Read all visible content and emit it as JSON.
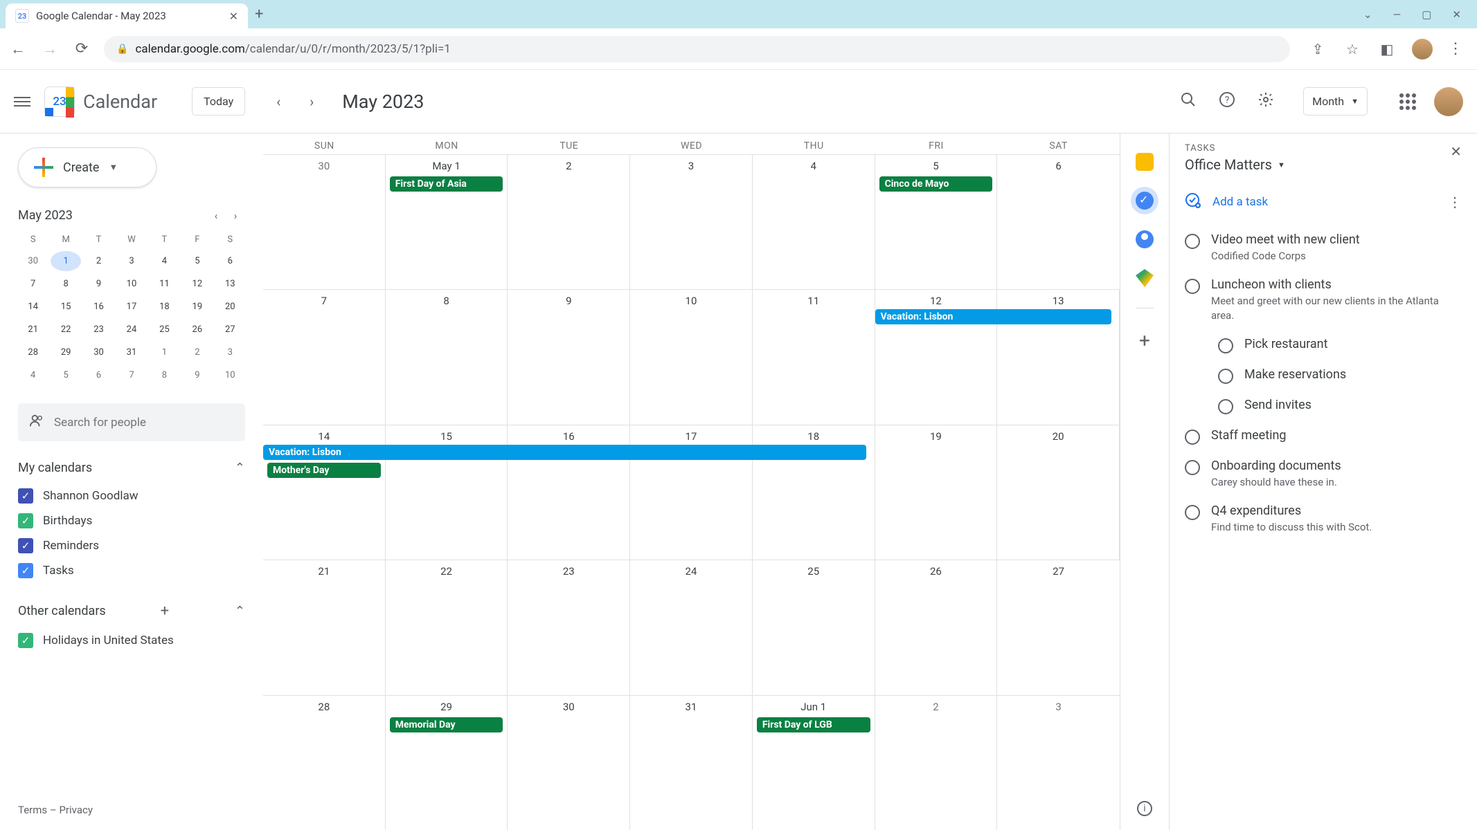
{
  "browser": {
    "tab_title": "Google Calendar - May 2023",
    "url_prefix": "calendar.google.com",
    "url_path": "/calendar/u/0/r/month/2023/5/1?pli=1",
    "favicon_text": "23"
  },
  "header": {
    "logo_day": "23",
    "app_name": "Calendar",
    "today_label": "Today",
    "current_period": "May 2023",
    "view_label": "Month"
  },
  "sidebar": {
    "create_label": "Create",
    "mini_month": "May 2023",
    "mini_day_headers": [
      "S",
      "M",
      "T",
      "W",
      "T",
      "F",
      "S"
    ],
    "mini_days": [
      {
        "n": "30",
        "muted": true
      },
      {
        "n": "1",
        "selected": true
      },
      {
        "n": "2"
      },
      {
        "n": "3"
      },
      {
        "n": "4"
      },
      {
        "n": "5"
      },
      {
        "n": "6"
      },
      {
        "n": "7"
      },
      {
        "n": "8"
      },
      {
        "n": "9"
      },
      {
        "n": "10"
      },
      {
        "n": "11"
      },
      {
        "n": "12"
      },
      {
        "n": "13"
      },
      {
        "n": "14"
      },
      {
        "n": "15"
      },
      {
        "n": "16"
      },
      {
        "n": "17"
      },
      {
        "n": "18"
      },
      {
        "n": "19"
      },
      {
        "n": "20"
      },
      {
        "n": "21"
      },
      {
        "n": "22"
      },
      {
        "n": "23"
      },
      {
        "n": "24"
      },
      {
        "n": "25"
      },
      {
        "n": "26"
      },
      {
        "n": "27"
      },
      {
        "n": "28"
      },
      {
        "n": "29"
      },
      {
        "n": "30"
      },
      {
        "n": "31"
      },
      {
        "n": "1",
        "muted": true
      },
      {
        "n": "2",
        "muted": true
      },
      {
        "n": "3",
        "muted": true
      },
      {
        "n": "4",
        "muted": true
      },
      {
        "n": "5",
        "muted": true
      },
      {
        "n": "6",
        "muted": true
      },
      {
        "n": "7",
        "muted": true
      },
      {
        "n": "8",
        "muted": true
      },
      {
        "n": "9",
        "muted": true
      },
      {
        "n": "10",
        "muted": true
      }
    ],
    "search_placeholder": "Search for people",
    "my_calendars_label": "My calendars",
    "my_calendars": [
      {
        "label": "Shannon Goodlaw",
        "color": "cb-blue"
      },
      {
        "label": "Birthdays",
        "color": "cb-green"
      },
      {
        "label": "Reminders",
        "color": "cb-blue"
      },
      {
        "label": "Tasks",
        "color": "cb-lblue"
      }
    ],
    "other_calendars_label": "Other calendars",
    "other_calendars": [
      {
        "label": "Holidays in United States",
        "color": "cb-green"
      }
    ],
    "terms": "Terms",
    "privacy": "Privacy"
  },
  "calendar": {
    "day_headers": [
      "SUN",
      "MON",
      "TUE",
      "WED",
      "THU",
      "FRI",
      "SAT"
    ],
    "weeks": [
      {
        "days": [
          {
            "num": "30",
            "muted": true
          },
          {
            "num": "May 1",
            "events": [
              {
                "title": "First Day of Asia",
                "color": "green"
              }
            ]
          },
          {
            "num": "2"
          },
          {
            "num": "3"
          },
          {
            "num": "4"
          },
          {
            "num": "5",
            "events": [
              {
                "title": "Cinco de Mayo",
                "color": "green"
              }
            ]
          },
          {
            "num": "6"
          }
        ]
      },
      {
        "days": [
          {
            "num": "7"
          },
          {
            "num": "8"
          },
          {
            "num": "9"
          },
          {
            "num": "10"
          },
          {
            "num": "11"
          },
          {
            "num": "12"
          },
          {
            "num": "13"
          }
        ],
        "span": {
          "title": "Vacation: Lisbon",
          "start": 5,
          "end": 7
        }
      },
      {
        "days": [
          {
            "num": "14",
            "events": [
              {
                "title": "Mother's Day",
                "color": "green",
                "offset": true
              }
            ]
          },
          {
            "num": "15"
          },
          {
            "num": "16"
          },
          {
            "num": "17"
          },
          {
            "num": "18"
          },
          {
            "num": "19"
          },
          {
            "num": "20"
          }
        ],
        "span": {
          "title": "Vacation: Lisbon",
          "start": 0,
          "end": 5
        }
      },
      {
        "days": [
          {
            "num": "21"
          },
          {
            "num": "22"
          },
          {
            "num": "23"
          },
          {
            "num": "24"
          },
          {
            "num": "25"
          },
          {
            "num": "26"
          },
          {
            "num": "27"
          }
        ]
      },
      {
        "days": [
          {
            "num": "28"
          },
          {
            "num": "29",
            "events": [
              {
                "title": "Memorial Day",
                "color": "green"
              }
            ]
          },
          {
            "num": "30"
          },
          {
            "num": "31"
          },
          {
            "num": "Jun 1",
            "events": [
              {
                "title": "First Day of LGB",
                "color": "green"
              }
            ]
          },
          {
            "num": "2",
            "muted": true
          },
          {
            "num": "3",
            "muted": true
          }
        ]
      }
    ]
  },
  "tasks": {
    "panel_label": "TASKS",
    "list_name": "Office Matters",
    "add_task_label": "Add a task",
    "items": [
      {
        "title": "Video meet with new client",
        "desc": "Codified Code Corps"
      },
      {
        "title": "Luncheon with clients",
        "desc": "Meet and greet with our new clients in the Atlanta area.",
        "subs": [
          {
            "title": "Pick restaurant"
          },
          {
            "title": "Make reservations"
          },
          {
            "title": "Send invites"
          }
        ]
      },
      {
        "title": "Staff meeting"
      },
      {
        "title": "Onboarding documents",
        "desc": "Carey should have these in."
      },
      {
        "title": "Q4 expenditures",
        "desc": "Find time to discuss this with Scot."
      }
    ]
  }
}
